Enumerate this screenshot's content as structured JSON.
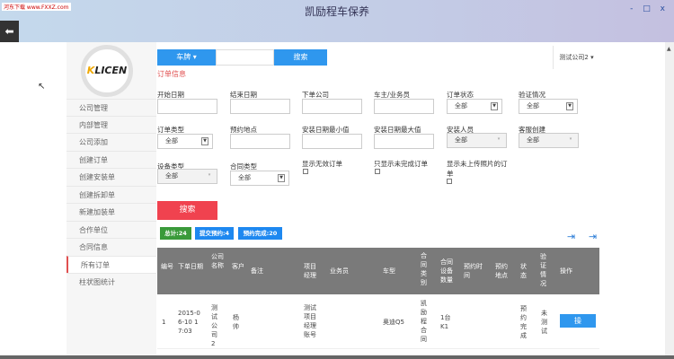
{
  "window": {
    "title": "凯励程车保养",
    "watermark": "河东下载 www.FXXZ.com",
    "controls": [
      "-",
      "□",
      "x"
    ]
  },
  "back_icon": "arrow-left-icon",
  "logo": {
    "text_k": "K",
    "text_rest": "LICEN"
  },
  "sidebar": {
    "items": [
      {
        "label": "公司管理"
      },
      {
        "label": "内部管理"
      },
      {
        "label": "公司添加"
      },
      {
        "label": "创建订单"
      },
      {
        "label": "创建安装单"
      },
      {
        "label": "创建拆卸单"
      },
      {
        "label": "新建加装单"
      },
      {
        "label": "合作单位"
      },
      {
        "label": "合同信息"
      },
      {
        "label": "所有订单",
        "active": true
      },
      {
        "label": "柱状图统计"
      }
    ]
  },
  "topbar": {
    "select_label": "车牌 ▾",
    "search_value": "",
    "search_button": "搜索",
    "company": "测试公司2 ▾"
  },
  "section_title": "订单信息",
  "filters": {
    "start_date": "开始日期",
    "end_date": "结束日期",
    "order_company": "下单公司",
    "owner": "车主/业务员",
    "order_status": {
      "label": "订单状态",
      "value": "全部"
    },
    "verify": {
      "label": "验证情况",
      "value": "全部"
    },
    "order_type": {
      "label": "订单类型",
      "value": "全部"
    },
    "location": "预约地点",
    "install_min": "安装日期最小值",
    "install_max": "安装日期最大值",
    "installer": {
      "label": "安装人员",
      "value": "全部"
    },
    "service": {
      "label": "客服创建",
      "value": "全部"
    },
    "device_type": {
      "label": "设备类型",
      "value": "全部"
    },
    "contract_type": {
      "label": "合同类型",
      "value": "全部"
    },
    "show_invalid": "显示无效订单",
    "show_unfinished": "只显示未完成订单",
    "show_no_photo": "显示未上传照片的订单"
  },
  "search_button": "搜索",
  "badges": {
    "total": "总计:24",
    "submitted": "提交预约:4",
    "done": "预约完成:20"
  },
  "colors": {
    "blue": "#2f97ee",
    "red": "#f0424f",
    "green": "#3a9a3a"
  },
  "table": {
    "headers": [
      "编号",
      "下单日期",
      "公司名称",
      "客户",
      "备注",
      "项目经理",
      "业务员",
      "车型",
      "合同类别",
      "合同设备数量",
      "预约时间",
      "预约地点",
      "状态",
      "验证情况",
      "操作"
    ],
    "rows": [
      {
        "id": "1",
        "date": "2015-06-10 17:03",
        "company": "测试公司2",
        "customer": "杨帅",
        "note": "",
        "manager": "测试项目经理账号",
        "sales": "",
        "car": "奥迪Q5",
        "contract": "凯励程合同",
        "qty": "1台 K1",
        "time": "",
        "place": "",
        "status": "预约完成",
        "verify": "未测试",
        "op": "操"
      }
    ]
  }
}
